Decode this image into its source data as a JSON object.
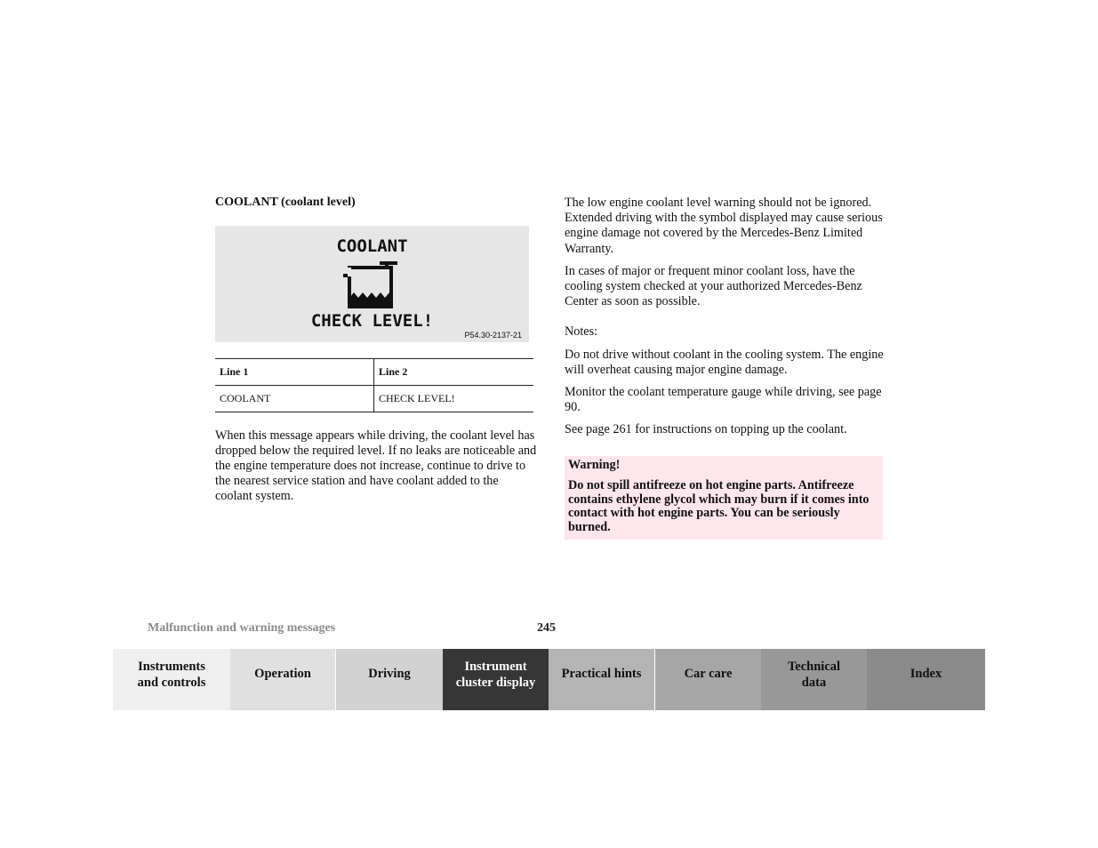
{
  "section": {
    "title": "COOLANT (coolant level)"
  },
  "display_figure": {
    "line1": "COOLANT",
    "line2": "CHECK LEVEL!",
    "icon": "coolant-reservoir-icon",
    "figure_code": "P54.30-2137-21",
    "background_color": "#e6e6e6"
  },
  "message_table": {
    "headers": [
      "Line 1",
      "Line 2"
    ],
    "rows": [
      [
        "COOLANT",
        "CHECK LEVEL!"
      ]
    ]
  },
  "left_paragraph": "When this message appears while driving, the coolant level has dropped below the required level. If no leaks are noticeable and the engine temperature does not increase, continue to drive to the nearest service station and have coolant added to the coolant system.",
  "right_column": {
    "paragraphs": [
      "The low engine coolant level warning should not be ignored. Extended driving with the symbol displayed may cause serious engine damage not covered by the Mercedes-Benz Limited Warranty.",
      "In cases of major or frequent minor coolant loss, have the cooling system checked at your authorized Mercedes-Benz Center as soon as possible."
    ],
    "notes_label": "Notes:",
    "notes": [
      "Do not drive without coolant in the cooling system. The engine will overheat causing major engine damage.",
      "Monitor the coolant temperature gauge while driving, see page 90.",
      "See page 261 for instructions on topping up the coolant."
    ]
  },
  "warning": {
    "title": "Warning!",
    "text": "Do not spill antifreeze on hot engine parts. Antifreeze contains ethylene glycol which may burn if it comes into contact with hot engine parts. You can be seriously burned.",
    "background_color": "#fde6ec"
  },
  "footer": {
    "section_name": "Malfunction and warning messages",
    "page_number": "245"
  },
  "tabs": [
    {
      "label": "Instruments and controls",
      "color": "#efefef",
      "active": false
    },
    {
      "label": "Operation",
      "color": "#e0e0e0",
      "active": false
    },
    {
      "label": "Driving",
      "color": "#d2d2d2",
      "active": false
    },
    {
      "label": "Instrument cluster display",
      "color": "#363636",
      "active": true
    },
    {
      "label": "Practical hints",
      "color": "#b4b4b4",
      "active": false
    },
    {
      "label": "Car care",
      "color": "#a6a6a6",
      "active": false
    },
    {
      "label": "Technical data",
      "color": "#989898",
      "active": false
    },
    {
      "label": "Index",
      "color": "#8a8a8a",
      "active": false
    }
  ]
}
